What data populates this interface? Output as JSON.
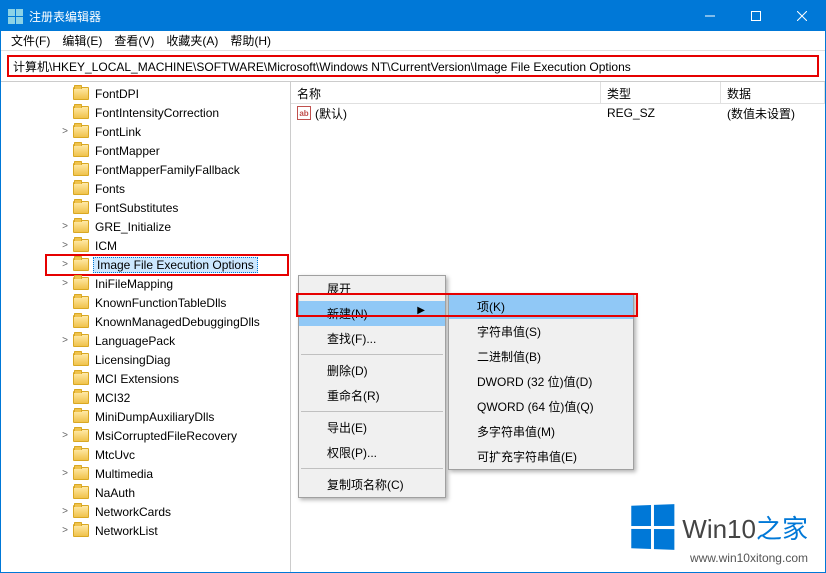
{
  "title": "注册表编辑器",
  "menus": {
    "file": "文件(F)",
    "edit": "编辑(E)",
    "view": "查看(V)",
    "fav": "收藏夹(A)",
    "help": "帮助(H)"
  },
  "address": "计算机\\HKEY_LOCAL_MACHINE\\SOFTWARE\\Microsoft\\Windows NT\\CurrentVersion\\Image File Execution Options",
  "list": {
    "headers": {
      "name": "名称",
      "type": "类型",
      "data": "数据"
    },
    "rows": [
      {
        "name": "(默认)",
        "type": "REG_SZ",
        "data": "(数值未设置)"
      }
    ]
  },
  "tree": [
    {
      "label": "FontDPI",
      "exp": ""
    },
    {
      "label": "FontIntensityCorrection",
      "exp": ""
    },
    {
      "label": "FontLink",
      "exp": ">"
    },
    {
      "label": "FontMapper",
      "exp": ""
    },
    {
      "label": "FontMapperFamilyFallback",
      "exp": ""
    },
    {
      "label": "Fonts",
      "exp": ""
    },
    {
      "label": "FontSubstitutes",
      "exp": ""
    },
    {
      "label": "GRE_Initialize",
      "exp": ">"
    },
    {
      "label": "ICM",
      "exp": ">"
    },
    {
      "label": "Image File Execution Options",
      "exp": ">",
      "selected": true
    },
    {
      "label": "IniFileMapping",
      "exp": ">"
    },
    {
      "label": "KnownFunctionTableDlls",
      "exp": ""
    },
    {
      "label": "KnownManagedDebuggingDlls",
      "exp": ""
    },
    {
      "label": "LanguagePack",
      "exp": ">"
    },
    {
      "label": "LicensingDiag",
      "exp": ""
    },
    {
      "label": "MCI Extensions",
      "exp": ""
    },
    {
      "label": "MCI32",
      "exp": ""
    },
    {
      "label": "MiniDumpAuxiliaryDlls",
      "exp": ""
    },
    {
      "label": "MsiCorruptedFileRecovery",
      "exp": ">"
    },
    {
      "label": "MtcUvc",
      "exp": ""
    },
    {
      "label": "Multimedia",
      "exp": ">"
    },
    {
      "label": "NaAuth",
      "exp": ""
    },
    {
      "label": "NetworkCards",
      "exp": ">"
    },
    {
      "label": "NetworkList",
      "exp": ">"
    }
  ],
  "context_menu": {
    "items": [
      {
        "label": "展开",
        "type": "item"
      },
      {
        "label": "新建(N)",
        "type": "submenu",
        "hl": true
      },
      {
        "label": "查找(F)...",
        "type": "item"
      },
      {
        "type": "sep"
      },
      {
        "label": "删除(D)",
        "type": "item"
      },
      {
        "label": "重命名(R)",
        "type": "item"
      },
      {
        "type": "sep"
      },
      {
        "label": "导出(E)",
        "type": "item"
      },
      {
        "label": "权限(P)...",
        "type": "item"
      },
      {
        "type": "sep"
      },
      {
        "label": "复制项名称(C)",
        "type": "item"
      }
    ]
  },
  "submenu": {
    "items": [
      {
        "label": "项(K)",
        "hl": true
      },
      {
        "type": "sep"
      },
      {
        "label": "字符串值(S)"
      },
      {
        "label": "二进制值(B)"
      },
      {
        "label": "DWORD (32 位)值(D)"
      },
      {
        "label": "QWORD (64 位)值(Q)"
      },
      {
        "label": "多字符串值(M)"
      },
      {
        "label": "可扩充字符串值(E)"
      }
    ]
  },
  "watermark": {
    "brand_a": "Win10",
    "brand_b": "之家",
    "url": "www.win10xitong.com"
  }
}
